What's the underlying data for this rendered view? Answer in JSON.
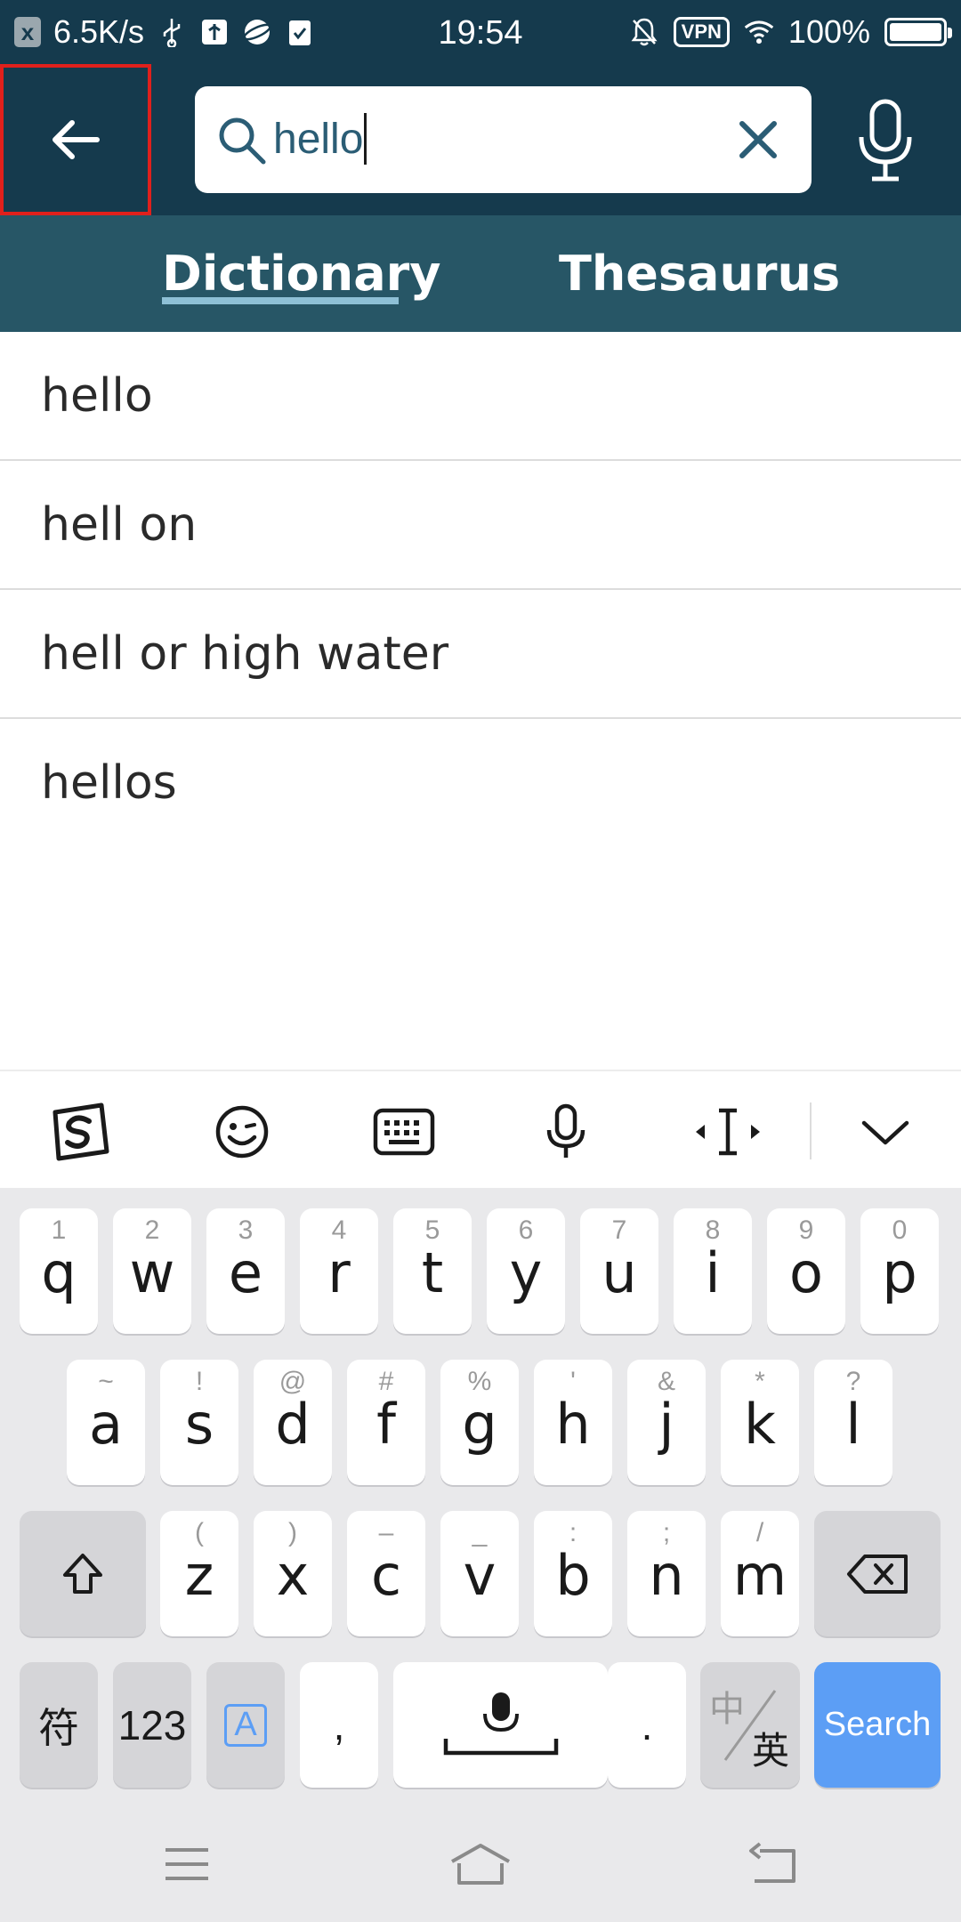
{
  "status_bar": {
    "net_speed": "6.5K/s",
    "time": "19:54",
    "vpn": "VPN",
    "battery": "100%",
    "left_badge": "x"
  },
  "search": {
    "query": "hello",
    "back_icon": "arrow-left-icon",
    "clear_icon": "close-icon",
    "mic_icon": "microphone-icon"
  },
  "tabs": [
    {
      "label": "Dictionary",
      "active": true
    },
    {
      "label": "Thesaurus",
      "active": false
    }
  ],
  "suggestions": [
    "hello",
    "hell on",
    "hell or high water",
    "hellos"
  ],
  "keyboard": {
    "row1": [
      {
        "hint": "1",
        "key": "q"
      },
      {
        "hint": "2",
        "key": "w"
      },
      {
        "hint": "3",
        "key": "e"
      },
      {
        "hint": "4",
        "key": "r"
      },
      {
        "hint": "5",
        "key": "t"
      },
      {
        "hint": "6",
        "key": "y"
      },
      {
        "hint": "7",
        "key": "u"
      },
      {
        "hint": "8",
        "key": "i"
      },
      {
        "hint": "9",
        "key": "o"
      },
      {
        "hint": "0",
        "key": "p"
      }
    ],
    "row2": [
      {
        "hint": "~",
        "key": "a"
      },
      {
        "hint": "!",
        "key": "s"
      },
      {
        "hint": "@",
        "key": "d"
      },
      {
        "hint": "#",
        "key": "f"
      },
      {
        "hint": "%",
        "key": "g"
      },
      {
        "hint": "'",
        "key": "h"
      },
      {
        "hint": "&",
        "key": "j"
      },
      {
        "hint": "*",
        "key": "k"
      },
      {
        "hint": "?",
        "key": "l"
      }
    ],
    "row3": [
      {
        "hint": "(",
        "key": "z"
      },
      {
        "hint": ")",
        "key": "x"
      },
      {
        "hint": "–",
        "key": "c"
      },
      {
        "hint": "_",
        "key": "v"
      },
      {
        "hint": ":",
        "key": "b"
      },
      {
        "hint": ";",
        "key": "n"
      },
      {
        "hint": "/",
        "key": "m"
      }
    ],
    "symbols_label": "符",
    "numbers_label": "123",
    "lang_label": "A",
    "comma_label": ",",
    "period_label": ".",
    "switch_top": "中",
    "switch_bottom": "英",
    "search_label": "Search"
  },
  "colors": {
    "header": "#153a4d",
    "tabs": "#275666",
    "accent": "#8ec0d6",
    "search_key": "#5c9ef5",
    "highlight": "#e0201c"
  }
}
